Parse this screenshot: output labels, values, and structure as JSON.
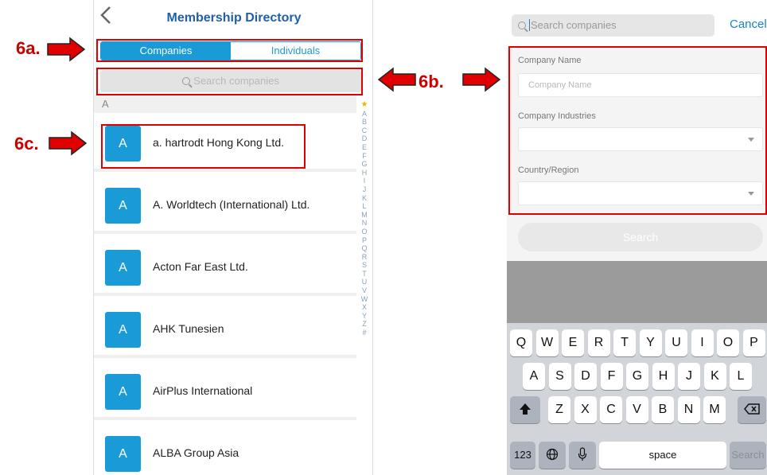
{
  "left": {
    "title": "Membership Directory",
    "back_icon": "chevron-left-icon",
    "tabs": [
      {
        "label": "Companies",
        "active": true
      },
      {
        "label": "Individuals",
        "active": false
      }
    ],
    "search_placeholder": "Search companies",
    "section_letter": "A",
    "items": [
      {
        "avatar": "A",
        "name": "a. hartrodt Hong Kong Ltd."
      },
      {
        "avatar": "A",
        "name": "A. Worldtech (International) Ltd."
      },
      {
        "avatar": "A",
        "name": "Acton Far East  Ltd."
      },
      {
        "avatar": "A",
        "name": "AHK Tunesien"
      },
      {
        "avatar": "A",
        "name": "AirPlus International"
      },
      {
        "avatar": "A",
        "name": "ALBA Group Asia"
      }
    ],
    "index": [
      "★",
      "A",
      "B",
      "C",
      "D",
      "E",
      "F",
      "G",
      "H",
      "I",
      "J",
      "K",
      "L",
      "M",
      "N",
      "O",
      "P",
      "Q",
      "R",
      "S",
      "T",
      "U",
      "V",
      "W",
      "X",
      "Y",
      "Z",
      "#"
    ]
  },
  "right": {
    "search_placeholder": "Search companies",
    "cancel": "Cancel",
    "fields": {
      "company_name_label": "Company Name",
      "company_name_placeholder": "Company Name",
      "industries_label": "Company Industries",
      "country_label": "Country/Region"
    },
    "submit": "Search",
    "keyboard": {
      "row1": [
        "Q",
        "W",
        "E",
        "R",
        "T",
        "Y",
        "U",
        "I",
        "O",
        "P"
      ],
      "row2": [
        "A",
        "S",
        "D",
        "F",
        "G",
        "H",
        "J",
        "K",
        "L"
      ],
      "row3": [
        "Z",
        "X",
        "C",
        "V",
        "B",
        "N",
        "M"
      ],
      "numbers": "123",
      "space": "space",
      "search": "Search"
    }
  },
  "annotations": {
    "a": "6a.",
    "b": "6b.",
    "c": "6c."
  },
  "colors": {
    "accent": "#1a9bd7",
    "title": "#1f5fa8",
    "annotation": "#e00000"
  }
}
